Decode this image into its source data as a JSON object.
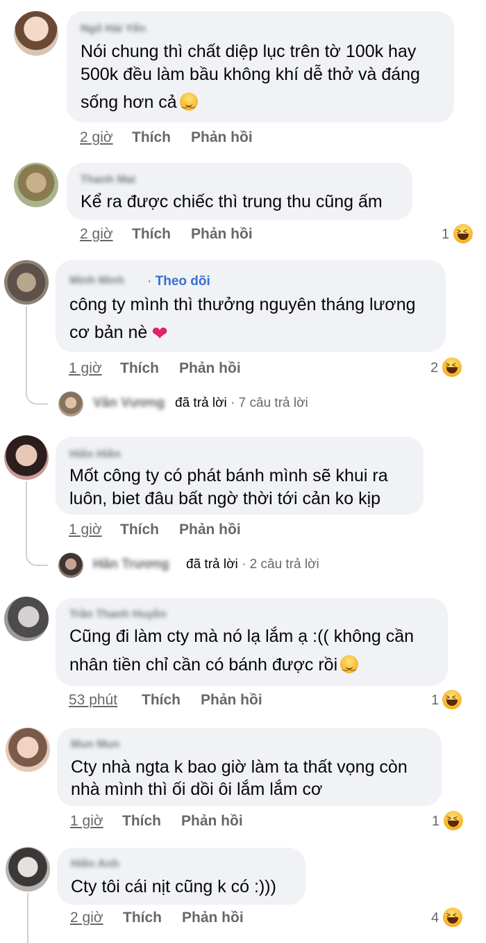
{
  "comments": [
    {
      "name": "Ngô Hải Yến",
      "lines": [
        "Nói chung thì chất diệp lục trên tờ 100k hay",
        "500k đều làm bầu không khí dễ thở và đáng",
        "sống hơn cả"
      ],
      "emoji": "relieved-face",
      "time": "2 giờ",
      "like": "Thích",
      "reply": "Phản hồi"
    },
    {
      "name": "Thanh Mai",
      "lines": [
        "Kể ra được chiếc thì trung thu cũng ấm"
      ],
      "time": "2 giờ",
      "like": "Thích",
      "reply": "Phản hồi",
      "reaction_count": "1"
    },
    {
      "name": "Minh Minh",
      "follow_sep": "·",
      "follow": "Theo dõi",
      "lines": [
        "công ty mình thì thưởng nguyên tháng lương",
        "cơ bản nè"
      ],
      "emoji": "red-heart",
      "time": "1 giờ",
      "like": "Thích",
      "reply": "Phản hồi",
      "reaction_count": "2",
      "replies": {
        "name": "Vân Vương",
        "action": "đã trả lời",
        "summary": "· 7 câu trả lời"
      }
    },
    {
      "name": "Hiền Hiền",
      "lines": [
        "Mốt công ty có phát bánh mình sẽ khui ra",
        "luôn, biet đâu bất ngờ thời tới cản ko kịp"
      ],
      "time": "1 giờ",
      "like": "Thích",
      "reply": "Phản hồi",
      "replies": {
        "name": "Hân Trương",
        "action": "đã trả lời",
        "summary": "· 2 câu trả lời"
      }
    },
    {
      "name": "Trần Thanh Huyền",
      "lines": [
        "Cũng đi làm cty mà nó lạ lắm ạ :(( không cần",
        "nhân tiền chỉ cần có bánh được rồi"
      ],
      "emoji": "relieved-face",
      "time": "53 phút",
      "like": "Thích",
      "reply": "Phản hồi",
      "reaction_count": "1"
    },
    {
      "name": "Mun Mun",
      "lines": [
        "Cty nhà ngta k bao giờ làm ta thất vọng còn",
        "nhà mình thì ối dồi ôi lắm lắm cơ"
      ],
      "time": "1 giờ",
      "like": "Thích",
      "reply": "Phản hồi",
      "reaction_count": "1"
    },
    {
      "name": "Hiền Anh",
      "lines": [
        "Cty tôi cái nịt cũng k có :)))"
      ],
      "time": "2 giờ",
      "like": "Thích",
      "reply": "Phản hồi",
      "reaction_count": "4"
    }
  ],
  "reaction_icon": "laughing-face-icon"
}
